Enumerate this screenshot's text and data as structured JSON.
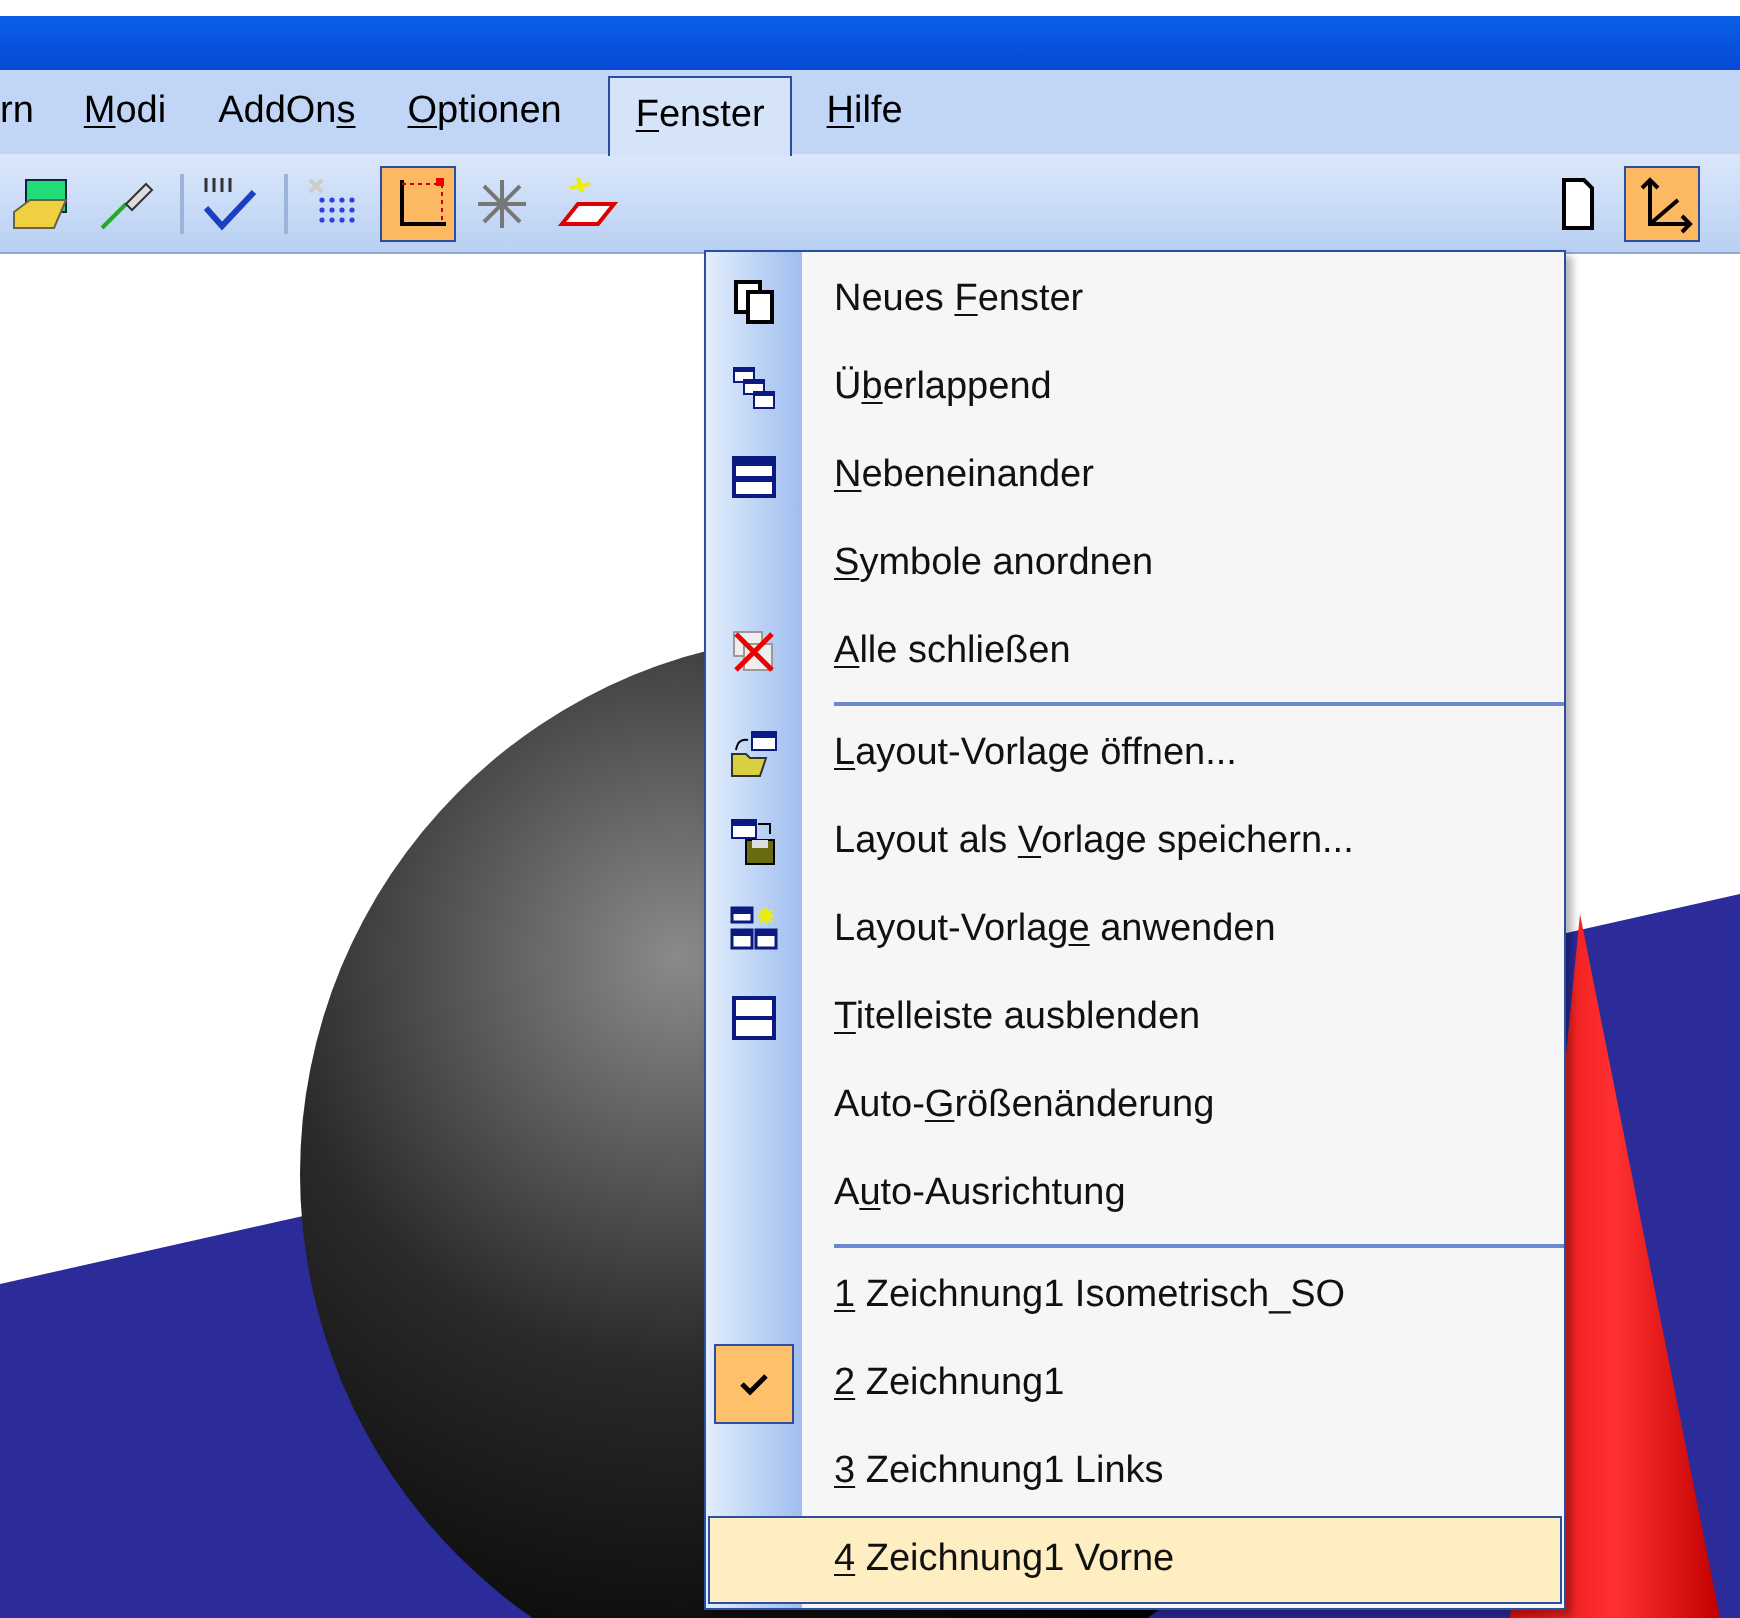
{
  "menubar": [
    {
      "label": {
        "before": "rn"
      },
      "selected": false
    },
    {
      "label": {
        "key": "M",
        "after": "odi"
      },
      "selected": false
    },
    {
      "label": {
        "before": "AddOn",
        "key": "s"
      },
      "selected": false
    },
    {
      "label": {
        "key": "O",
        "after": "ptionen"
      },
      "selected": false
    },
    {
      "label": {
        "key": "F",
        "after": "enster"
      },
      "selected": true
    },
    {
      "label": {
        "key": "H",
        "after": "ilfe"
      },
      "selected": false
    }
  ],
  "toolbar_left": [
    {
      "kind": "image",
      "pressed": false
    },
    {
      "kind": "pencil",
      "pressed": false
    },
    {
      "kind": "sep"
    },
    {
      "kind": "spell",
      "pressed": false
    },
    {
      "kind": "sep"
    },
    {
      "kind": "grid",
      "pressed": false
    },
    {
      "kind": "axes",
      "pressed": true
    },
    {
      "kind": "star",
      "pressed": false
    },
    {
      "kind": "plane",
      "pressed": false
    }
  ],
  "toolbar_right": [
    {
      "kind": "page",
      "pressed": false
    },
    {
      "kind": "axes2",
      "pressed": true
    }
  ],
  "menu": [
    {
      "kind": "new",
      "label": {
        "before": "Neues ",
        "key": "F",
        "after": "enster"
      }
    },
    {
      "kind": "cascade",
      "label": {
        "before": "Ü",
        "key": "b",
        "after": "erlappend"
      }
    },
    {
      "kind": "tile",
      "label": {
        "key": "N",
        "after": "ebeneinander"
      }
    },
    {
      "kind": "plain",
      "label": {
        "key": "S",
        "after": "ymbole anordnen"
      }
    },
    {
      "kind": "closeall",
      "label": {
        "key": "A",
        "after": "lle schließen"
      }
    },
    {
      "kind": "separator"
    },
    {
      "kind": "open",
      "label": {
        "key": "L",
        "after": "ayout-Vorlage öffnen..."
      }
    },
    {
      "kind": "save",
      "label": {
        "before": "Layout als ",
        "key": "V",
        "after": "orlage speichern..."
      }
    },
    {
      "kind": "apply",
      "label": {
        "before": "Layout-Vorlag",
        "key": "e",
        "after": " anwenden"
      }
    },
    {
      "kind": "titlebar",
      "label": {
        "key": "T",
        "after": "itelleiste ausblenden"
      }
    },
    {
      "kind": "plain",
      "label": {
        "before": "Auto-",
        "key": "G",
        "after": "rößenänderung"
      }
    },
    {
      "kind": "plain",
      "label": {
        "before": "A",
        "key": "u",
        "after": "to-Ausrichtung"
      }
    },
    {
      "kind": "separator"
    },
    {
      "kind": "window",
      "checked": false,
      "highlighted": false,
      "label": {
        "key": "1",
        "after": " Zeichnung1 Isometrisch_SO"
      }
    },
    {
      "kind": "window",
      "checked": true,
      "highlighted": false,
      "label": {
        "key": "2",
        "after": " Zeichnung1"
      }
    },
    {
      "kind": "window",
      "checked": false,
      "highlighted": false,
      "label": {
        "key": "3",
        "after": " Zeichnung1 Links"
      }
    },
    {
      "kind": "window",
      "checked": false,
      "highlighted": true,
      "label": {
        "key": "4",
        "after": " Zeichnung1 Vorne"
      }
    }
  ]
}
